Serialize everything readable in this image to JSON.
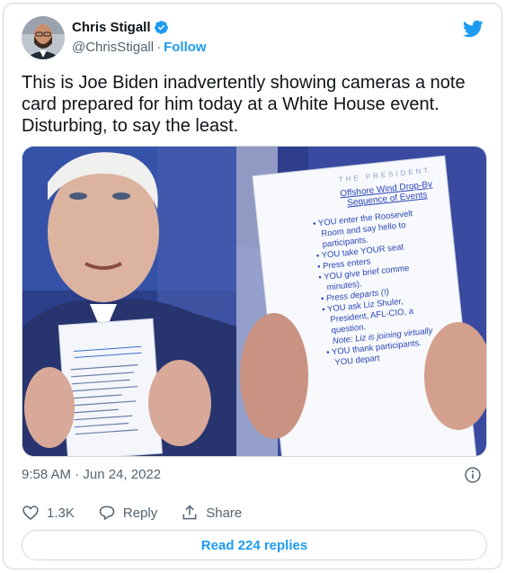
{
  "author": {
    "name": "Chris Stigall",
    "handle": "@ChrisStigall",
    "separator": "·",
    "follow_label": "Follow"
  },
  "tweet": {
    "text": "This is Joe Biden inadvertently showing cameras a note card prepared for him today at a White House event. Disturbing, to say the least."
  },
  "media": {
    "card_header": "THE PRESIDENT",
    "card_title_line1": "Offshore Wind Drop-By",
    "card_title_line2": "Sequence of Events",
    "card_lines": [
      "• YOU enter the Roosevelt",
      "Room and say hello to",
      "participants.",
      "• YOU take YOUR seat",
      "• Press enters",
      "• YOU give brief comme",
      "minutes).",
      "• Press departs (!)",
      "• YOU ask Liz Shuler,",
      "President, AFL-CIO, a",
      "question.",
      "Note: Liz is joining virtually",
      "• YOU thank participants.",
      "YOU depart"
    ]
  },
  "meta": {
    "timestamp": "9:58 AM · Jun 24, 2022"
  },
  "actions": {
    "likes": "1.3K",
    "reply_label": "Reply",
    "share_label": "Share"
  },
  "read_replies_label": "Read 224 replies",
  "colors": {
    "accent": "#1d9bf0",
    "text": "#0f1419",
    "muted": "#536471",
    "border": "#cfd9de"
  }
}
